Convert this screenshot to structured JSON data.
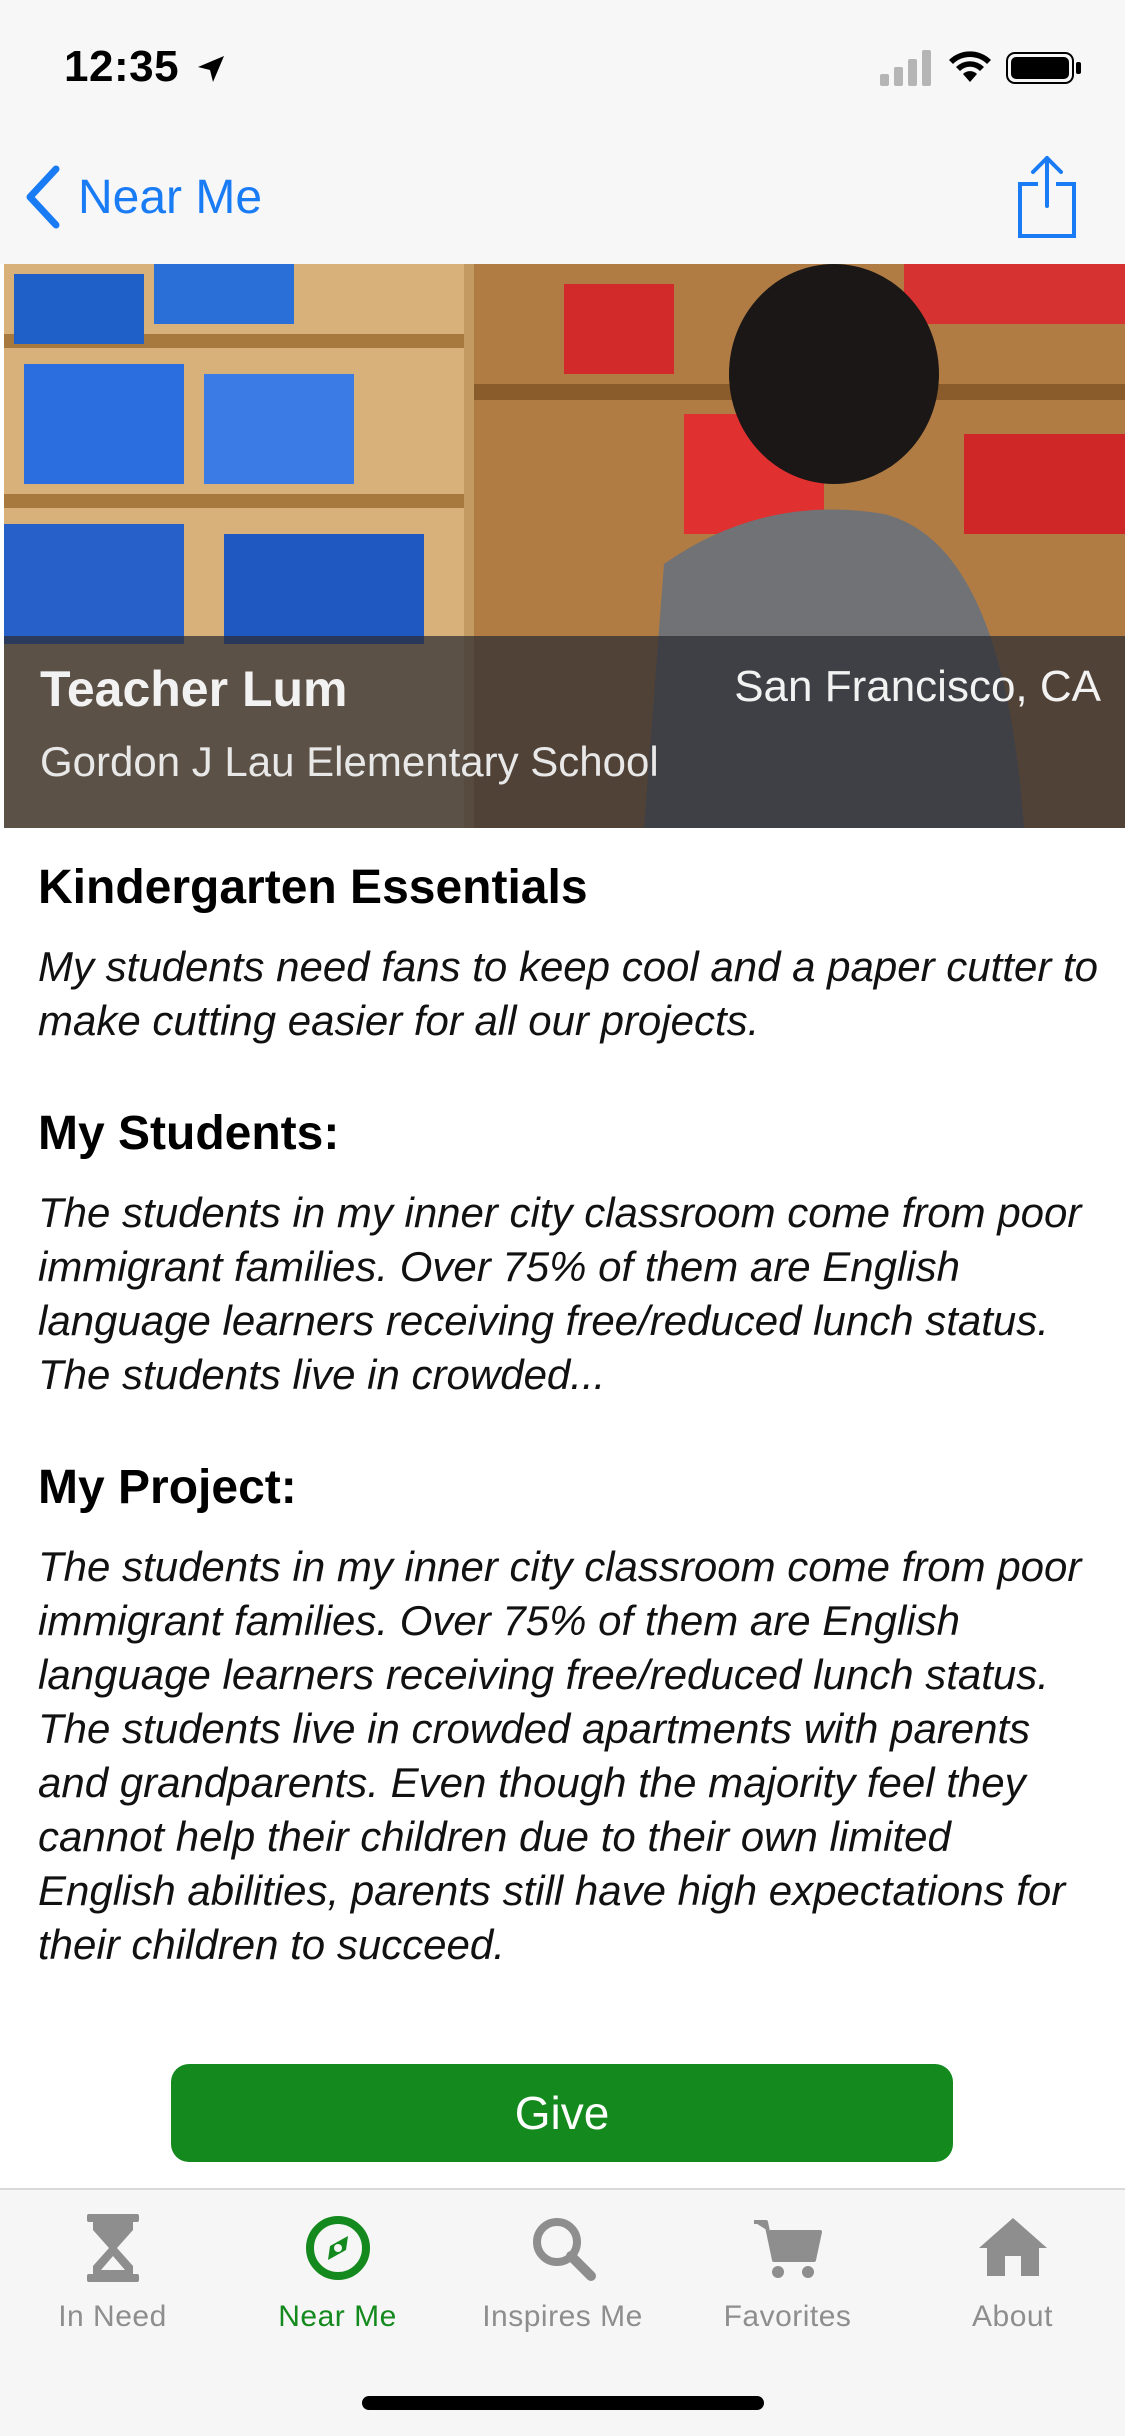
{
  "status_bar": {
    "time": "12:35"
  },
  "nav": {
    "back_label": "Near Me"
  },
  "hero": {
    "teacher": "Teacher Lum",
    "location": "San Francisco, CA",
    "school": "Gordon J Lau Elementary School"
  },
  "project": {
    "title": "Kindergarten Essentials",
    "summary": "My students need fans to keep cool and a paper cutter to make cutting easier for all our projects.",
    "students_heading": "My Students:",
    "students_text": "The students in my inner city classroom come from poor immigrant families. Over 75% of them are English language learners receiving free/reduced lunch status. The students live in crowded...",
    "project_heading": "My Project:",
    "project_text": "The students in my inner city classroom come from poor immigrant families.  Over 75% of them are English language learners receiving free/reduced lunch status.  The students live in crowded apartments with parents and grandparents.  Even though the majority feel they cannot help their children due to their own limited English abilities, parents still have high expectations for their children to succeed."
  },
  "give_label": "Give",
  "tabs": [
    {
      "label": "In Need",
      "icon": "hourglass-icon",
      "active": false
    },
    {
      "label": "Near Me",
      "icon": "compass-icon",
      "active": true
    },
    {
      "label": "Inspires Me",
      "icon": "search-icon",
      "active": false
    },
    {
      "label": "Favorites",
      "icon": "cart-icon",
      "active": false
    },
    {
      "label": "About",
      "icon": "home-icon",
      "active": false
    }
  ],
  "colors": {
    "accent_blue": "#1a7cf5",
    "give_green": "#148a1e",
    "tab_inactive": "#8e8e8e"
  }
}
